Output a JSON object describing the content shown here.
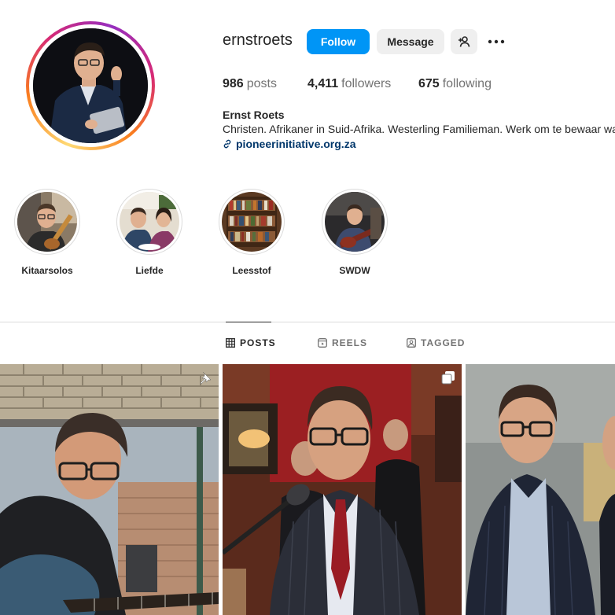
{
  "profile": {
    "username": "ernstroets",
    "follow_label": "Follow",
    "message_label": "Message",
    "stats": {
      "posts_count": "986",
      "posts_label": "posts",
      "followers_count": "4,411",
      "followers_label": "followers",
      "following_count": "675",
      "following_label": "following"
    },
    "full_name": "Ernst Roets",
    "bio": "Christen. Afrikaner in Suid-Afrika. Westerling Familieman. Werk om te bewaar wat",
    "link": "pioneerinitiative.org.za"
  },
  "highlights": [
    {
      "label": "Kitaarsolos"
    },
    {
      "label": "Liefde"
    },
    {
      "label": "Leesstof"
    },
    {
      "label": "SWDW"
    }
  ],
  "tabs": [
    {
      "label": "POSTS",
      "icon": "grid-icon",
      "active": true
    },
    {
      "label": "REELS",
      "icon": "reels-icon",
      "active": false
    },
    {
      "label": "TAGGED",
      "icon": "tagged-icon",
      "active": false
    }
  ],
  "posts": [
    {
      "badge": "pin-icon",
      "description": "man playing guitar"
    },
    {
      "badge": "carousel-icon",
      "description": "man speaking at microphone"
    },
    {
      "badge": "",
      "description": "two men posing"
    }
  ],
  "colors": {
    "accent": "#0095f6",
    "link": "#00376b",
    "muted": "#737373",
    "secondary_button": "#efefef"
  }
}
